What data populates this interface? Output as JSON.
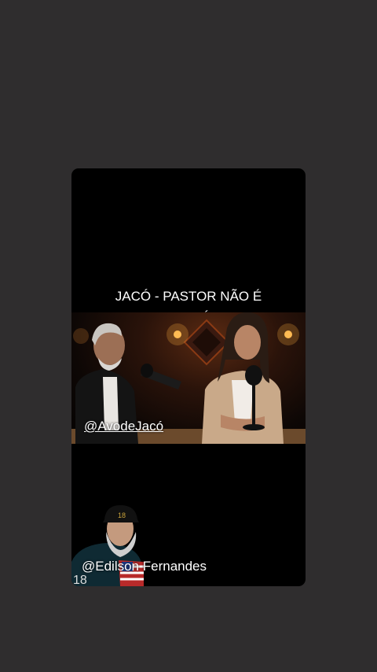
{
  "video": {
    "caption_line1": "JACÓ - PASTOR NÃO É",
    "caption_line2": "INTERMEDIÁRIO....",
    "guest_handle": "@AvodeJacó",
    "host_handle": "@Edilson Fernandes"
  }
}
